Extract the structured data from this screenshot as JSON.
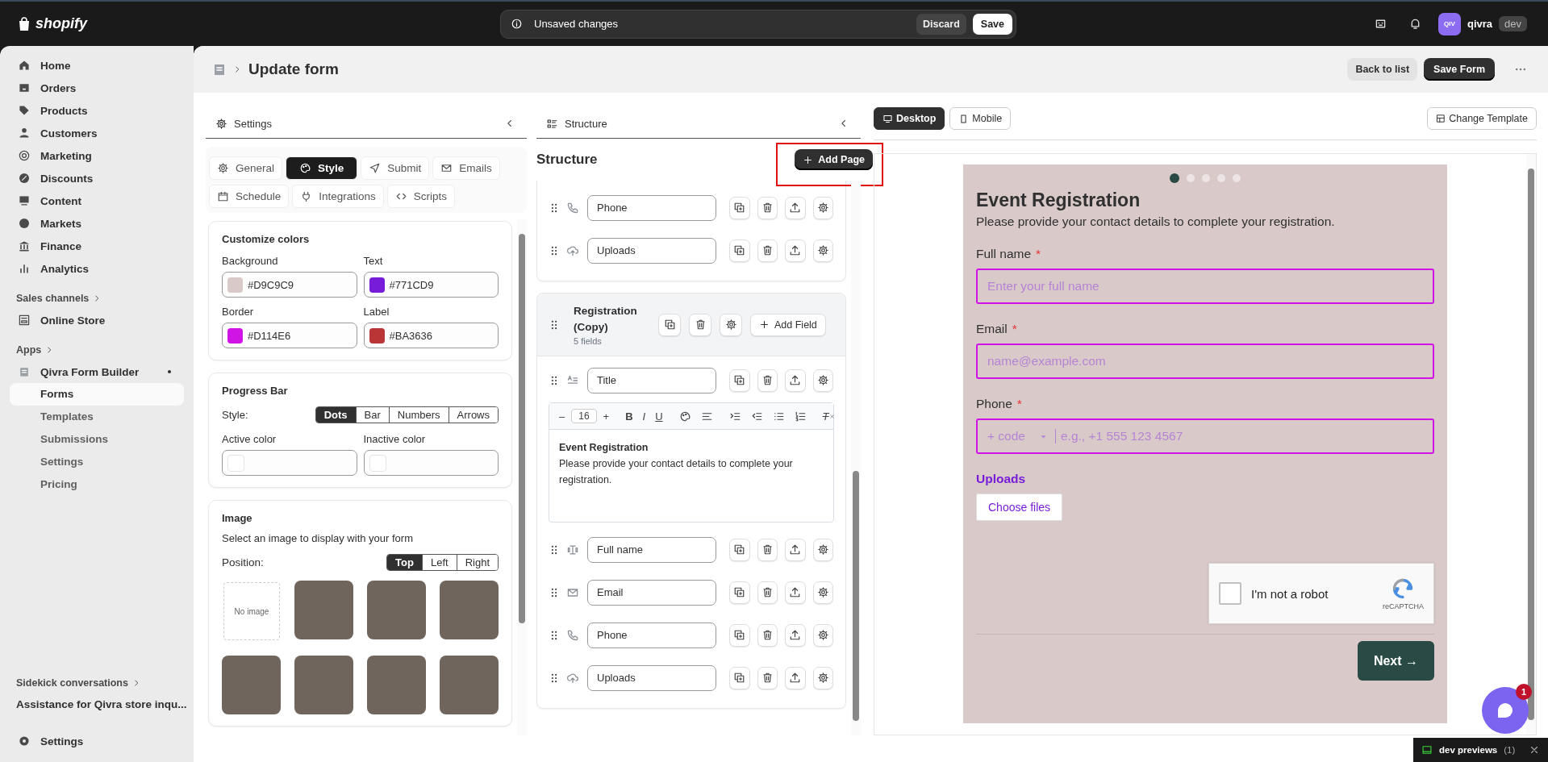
{
  "topbar": {
    "brand": "shopify",
    "notice": "Unsaved changes",
    "discard": "Discard",
    "save": "Save",
    "avatar": "QIV",
    "user": "qivra",
    "badge": "dev"
  },
  "sidebar": {
    "items": [
      {
        "label": "Home",
        "selected": false
      },
      {
        "label": "Orders",
        "selected": false
      },
      {
        "label": "Products",
        "selected": false
      },
      {
        "label": "Customers",
        "selected": false
      },
      {
        "label": "Marketing",
        "selected": false
      },
      {
        "label": "Discounts",
        "selected": false
      },
      {
        "label": "Content",
        "selected": false
      },
      {
        "label": "Markets",
        "selected": false
      },
      {
        "label": "Finance",
        "selected": false
      },
      {
        "label": "Analytics",
        "selected": false
      }
    ],
    "sales_channels": {
      "heading": "Sales channels",
      "items": [
        {
          "label": "Online Store",
          "selected": false
        }
      ]
    },
    "apps": {
      "heading": "Apps",
      "app": "Qivra Form Builder",
      "children": [
        {
          "label": "Forms",
          "selected": true
        },
        {
          "label": "Templates",
          "selected": false
        },
        {
          "label": "Submissions",
          "selected": false
        },
        {
          "label": "Settings",
          "selected": false
        },
        {
          "label": "Pricing",
          "selected": false
        }
      ]
    },
    "sidekick": {
      "heading": "Sidekick conversations",
      "items": [
        "Assistance for Qivra store inqu..."
      ]
    },
    "settings": "Settings"
  },
  "page": {
    "title": "Update form",
    "back": "Back to list",
    "save": "Save Form"
  },
  "settings_panel": {
    "title": "Settings",
    "tabs": [
      {
        "label": "General",
        "selected": false
      },
      {
        "label": "Style",
        "selected": true
      },
      {
        "label": "Submit",
        "selected": false
      },
      {
        "label": "Emails",
        "selected": false
      },
      {
        "label": "Schedule",
        "selected": false
      },
      {
        "label": "Integrations",
        "selected": false
      },
      {
        "label": "Scripts",
        "selected": false
      }
    ],
    "colors": {
      "title": "Customize colors",
      "fields": [
        {
          "label": "Background",
          "value": "#D9C9C9",
          "color": "#d9c9c9"
        },
        {
          "label": "Text",
          "value": "#771CD9",
          "color": "#771cd9"
        },
        {
          "label": "Border",
          "value": "#D114E6",
          "color": "#d114e6"
        },
        {
          "label": "Label",
          "value": "#BA3636",
          "color": "#ba3636"
        }
      ]
    },
    "progress_bar": {
      "title": "Progress Bar",
      "style_label": "Style:",
      "styles": [
        {
          "label": "Dots",
          "selected": true
        },
        {
          "label": "Bar",
          "selected": false
        },
        {
          "label": "Numbers",
          "selected": false
        },
        {
          "label": "Arrows",
          "selected": false
        }
      ],
      "active_label": "Active color",
      "inactive_label": "Inactive color"
    },
    "image": {
      "title": "Image",
      "description": "Select an image to display with your form",
      "position_label": "Position:",
      "positions": [
        {
          "label": "Top",
          "selected": true
        },
        {
          "label": "Left",
          "selected": false
        },
        {
          "label": "Right",
          "selected": false
        }
      ],
      "thumbnails": [
        {
          "kind": "none",
          "label": "No image"
        },
        {
          "kind": "photo"
        },
        {
          "kind": "photo"
        },
        {
          "kind": "photo"
        },
        {
          "kind": "photo"
        },
        {
          "kind": "photo"
        },
        {
          "kind": "photo"
        },
        {
          "kind": "photo"
        }
      ]
    }
  },
  "structure_panel": {
    "title": "Structure",
    "heading": "Structure",
    "add_page": "Add Page",
    "add_page_highlighted": true,
    "pages": [
      {
        "fields": [
          {
            "kind": "phone",
            "label": "Phone"
          },
          {
            "kind": "upload",
            "label": "Uploads"
          }
        ]
      },
      {
        "title": "Registration (Copy)",
        "count": "5 fields",
        "add_field": "Add Field",
        "fields": [
          {
            "kind": "title",
            "label": "Title",
            "editor": {
              "size": "16",
              "decrease": "–",
              "increase": "+",
              "tools": [
                {
                  "kind": "bold",
                  "label": "B"
                },
                {
                  "kind": "italic",
                  "label": "I"
                },
                {
                  "kind": "underline",
                  "label": "U"
                },
                {
                  "kind": "palette"
                },
                {
                  "kind": "align"
                },
                {
                  "kind": "indent"
                },
                {
                  "kind": "outdent"
                },
                {
                  "kind": "bullets"
                },
                {
                  "kind": "numbers"
                },
                {
                  "kind": "clear",
                  "label": "T"
                }
              ],
              "heading": "Event Registration",
              "body": "Please provide your contact details to complete your registration."
            }
          },
          {
            "kind": "name",
            "label": "Full name"
          },
          {
            "kind": "email",
            "label": "Email"
          },
          {
            "kind": "phone",
            "label": "Phone"
          },
          {
            "kind": "upload",
            "label": "Uploads"
          }
        ]
      }
    ]
  },
  "preview": {
    "views": [
      {
        "label": "Desktop",
        "selected": true
      },
      {
        "label": "Mobile",
        "selected": false
      }
    ],
    "change_template": "Change Template",
    "steps": [
      {
        "selected": true
      },
      {
        "selected": false
      },
      {
        "selected": false
      },
      {
        "selected": false
      },
      {
        "selected": false
      }
    ],
    "title": "Event Registration",
    "subtitle": "Please provide your contact details to complete your registration.",
    "fields": [
      {
        "kind": "text",
        "label": "Full name",
        "required_mark": "*",
        "placeholder": "Enter your full name"
      },
      {
        "kind": "text",
        "label": "Email",
        "required_mark": "*",
        "placeholder": "name@example.com"
      },
      {
        "kind": "phone",
        "label": "Phone",
        "required_mark": "*",
        "code": "+ code",
        "placeholder": "e.g., +1 555 123 4567"
      },
      {
        "kind": "upload",
        "label": "Uploads",
        "button": "Choose files"
      }
    ],
    "captcha": {
      "label": "I'm not a robot",
      "checked": false,
      "brand": "reCAPTCHA"
    },
    "next": "Next →"
  },
  "chat": {
    "badge": "1"
  },
  "dev_bar": {
    "label": "dev previews",
    "count": "(1)"
  }
}
